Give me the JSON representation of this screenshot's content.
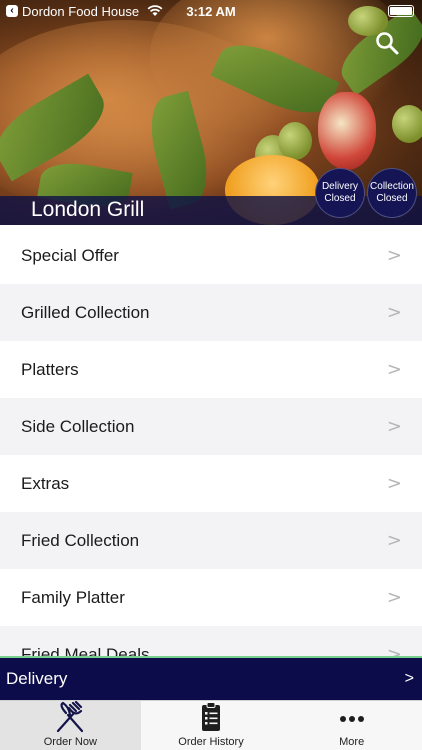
{
  "status_bar": {
    "back_app": "Dordon Food House",
    "time": "3:12 AM"
  },
  "header": {
    "restaurant_name": "London Grill",
    "search_icon": "search-icon",
    "delivery_status": {
      "line1": "Delivery",
      "line2": "Closed"
    },
    "collection_status": {
      "line1": "Collection",
      "line2": "Closed"
    },
    "accent_color": "#151556"
  },
  "menu": {
    "items": [
      {
        "label": "Special Offer"
      },
      {
        "label": "Grilled Collection"
      },
      {
        "label": "Platters"
      },
      {
        "label": "Side Collection"
      },
      {
        "label": "Extras"
      },
      {
        "label": "Fried Collection"
      },
      {
        "label": "Family Platter"
      },
      {
        "label": "Fried Meal Deals"
      }
    ],
    "chevron": ">"
  },
  "delivery_bar": {
    "label": "Delivery",
    "arrow": ">",
    "color": "#0d0c4a"
  },
  "tabbar": {
    "tabs": [
      {
        "label": "Order Now",
        "icon": "fork-knife-icon",
        "active": true
      },
      {
        "label": "Order History",
        "icon": "clipboard-list-icon",
        "active": false
      },
      {
        "label": "More",
        "icon": "more-dots-icon",
        "active": false
      }
    ]
  }
}
